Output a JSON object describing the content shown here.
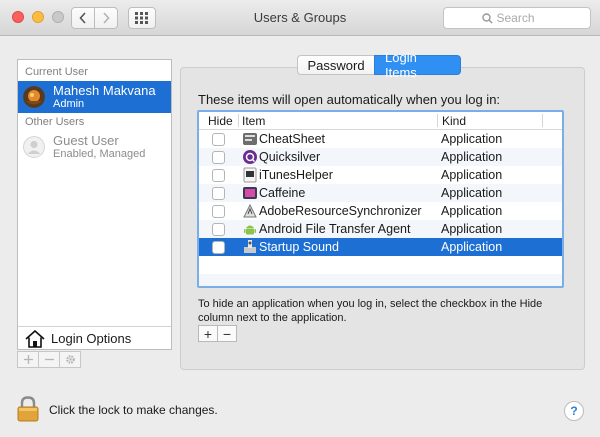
{
  "window": {
    "title": "Users & Groups",
    "search_placeholder": "Search"
  },
  "users": {
    "current_label": "Current User",
    "current": {
      "name": "Mahesh Makvana",
      "role": "Admin"
    },
    "other_label": "Other Users",
    "others": [
      {
        "name": "Guest User",
        "status": "Enabled, Managed"
      }
    ],
    "login_options": "Login Options"
  },
  "tabs": [
    {
      "label": "Password"
    },
    {
      "label": "Login Items"
    }
  ],
  "login_items": {
    "intro": "These items will open automatically when you log in:",
    "columns": {
      "hide": "Hide",
      "item": "Item",
      "kind": "Kind"
    },
    "rows": [
      {
        "name": "CheatSheet",
        "kind": "Application",
        "icon": "cheatsheet-icon"
      },
      {
        "name": "Quicksilver",
        "kind": "Application",
        "icon": "quicksilver-icon"
      },
      {
        "name": "iTunesHelper",
        "kind": "Application",
        "icon": "itunes-helper-icon"
      },
      {
        "name": "Caffeine",
        "kind": "Application",
        "icon": "caffeine-icon"
      },
      {
        "name": "AdobeResourceSynchronizer",
        "kind": "Application",
        "icon": "adobe-icon"
      },
      {
        "name": "Android File Transfer Agent",
        "kind": "Application",
        "icon": "android-icon"
      },
      {
        "name": "Startup Sound",
        "kind": "Application",
        "icon": "startup-sound-icon"
      }
    ],
    "selected_row": 6,
    "help": "To hide an application when you log in, select the checkbox in the Hide column next to the application.",
    "add_label": "+",
    "remove_label": "−"
  },
  "footer": {
    "lock_text": "Click the lock to make changes.",
    "help_label": "?"
  },
  "colors": {
    "selection": "#1d6fd3",
    "tab_active": "#2f8ff2"
  }
}
